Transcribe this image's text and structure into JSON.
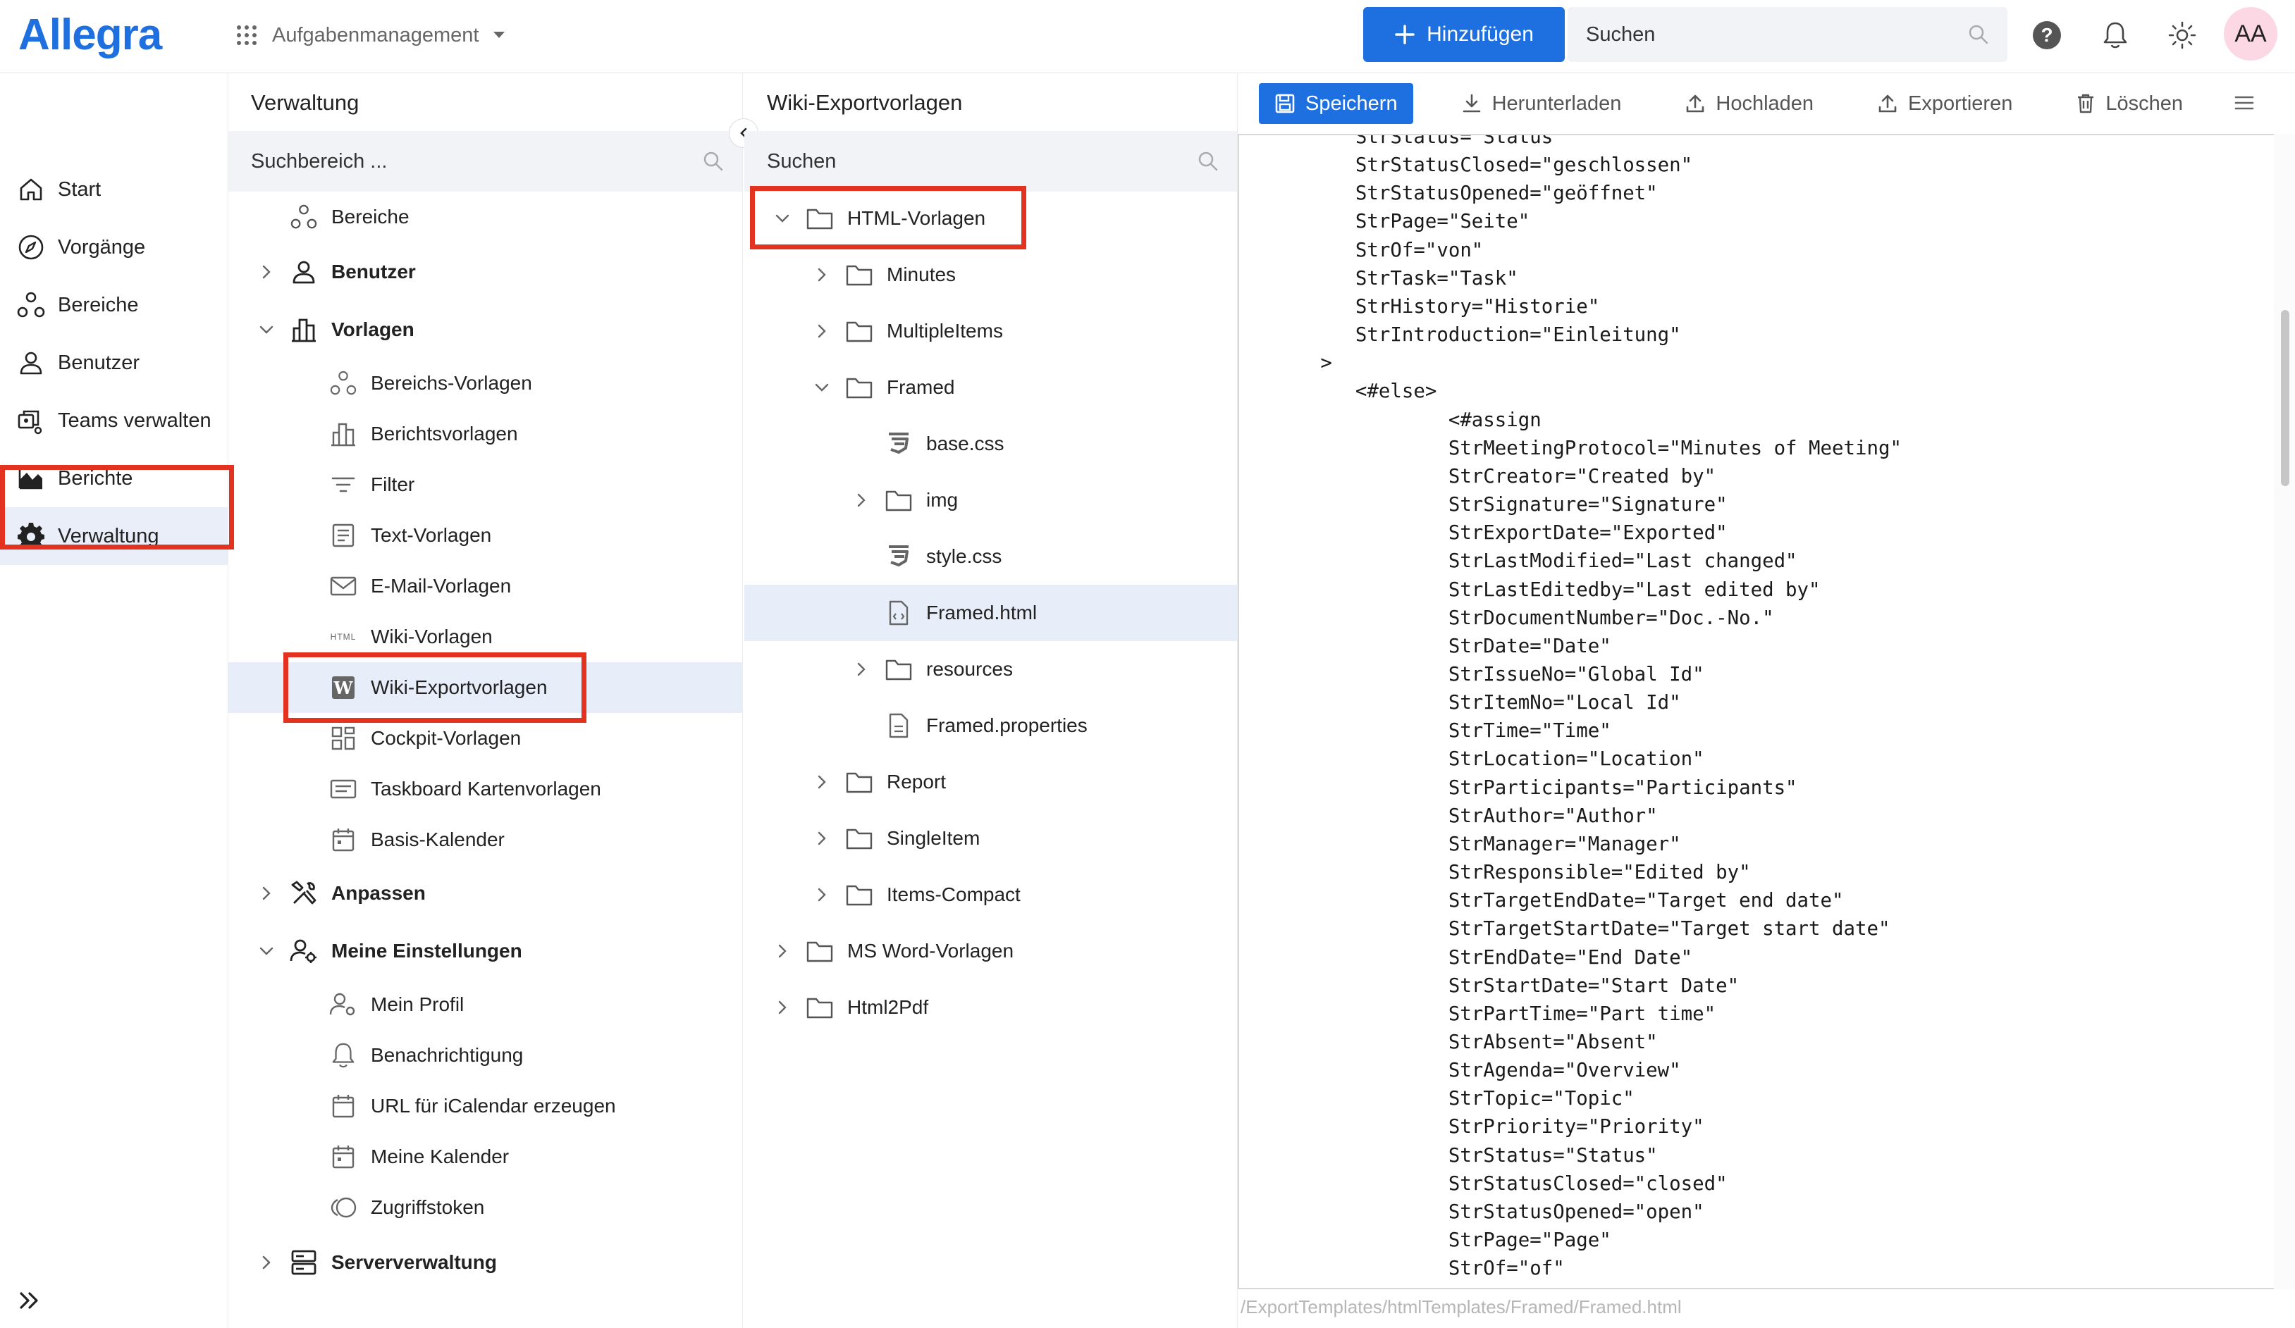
{
  "header": {
    "logo": "Allegra",
    "app_switcher_label": "Aufgabenmanagement",
    "add_button_label": "Hinzufügen",
    "search_placeholder": "Suchen",
    "avatar_initials": "AA",
    "brand_color": "#1e6fe0"
  },
  "leftnav": {
    "items": [
      {
        "label": "Start",
        "icon": "home-icon"
      },
      {
        "label": "Vorgänge",
        "icon": "compass-icon"
      },
      {
        "label": "Bereiche",
        "icon": "nodes-icon"
      },
      {
        "label": "Benutzer",
        "icon": "user-icon"
      },
      {
        "label": "Teams verwalten",
        "icon": "teams-icon"
      },
      {
        "label": "Berichte",
        "icon": "chart-area-icon"
      },
      {
        "label": "Verwaltung",
        "icon": "gear-icon",
        "active": true
      }
    ]
  },
  "admin_panel": {
    "title": "Verwaltung",
    "search_placeholder": "Suchbereich ...",
    "items": [
      {
        "label": "Bereiche"
      },
      {
        "label": "Benutzer"
      },
      {
        "label": "Vorlagen"
      },
      {
        "label": "Bereichs-Vorlagen"
      },
      {
        "label": "Berichtsvorlagen"
      },
      {
        "label": "Filter"
      },
      {
        "label": "Text-Vorlagen"
      },
      {
        "label": "E-Mail-Vorlagen"
      },
      {
        "label": "Wiki-Vorlagen",
        "icon_text": "HTML"
      },
      {
        "label": "Wiki-Exportvorlagen",
        "icon_text": "W",
        "selected": true
      },
      {
        "label": "Cockpit-Vorlagen"
      },
      {
        "label": "Taskboard Kartenvorlagen"
      },
      {
        "label": "Basis-Kalender"
      },
      {
        "label": "Anpassen"
      },
      {
        "label": "Meine Einstellungen"
      },
      {
        "label": "Mein Profil"
      },
      {
        "label": "Benachrichtigung"
      },
      {
        "label": "URL für iCalendar erzeugen"
      },
      {
        "label": "Meine Kalender"
      },
      {
        "label": "Zugriffstoken"
      },
      {
        "label": "Serververwaltung"
      }
    ]
  },
  "wiki_panel": {
    "title": "Wiki-Exportvorlagen",
    "search_placeholder": "Suchen",
    "items": [
      {
        "label": "HTML-Vorlagen",
        "expanded": true
      },
      {
        "label": "Minutes"
      },
      {
        "label": "MultipleItems"
      },
      {
        "label": "Framed",
        "expanded": true
      },
      {
        "label": "base.css"
      },
      {
        "label": "img"
      },
      {
        "label": "style.css"
      },
      {
        "label": "Framed.html",
        "selected": true
      },
      {
        "label": "resources"
      },
      {
        "label": "Framed.properties"
      },
      {
        "label": "Report"
      },
      {
        "label": "SingleItem"
      },
      {
        "label": "Items-Compact"
      },
      {
        "label": "MS Word-Vorlagen"
      },
      {
        "label": "Html2Pdf"
      }
    ]
  },
  "editor": {
    "toolbar": {
      "save": "Speichern",
      "download": "Herunterladen",
      "upload": "Hochladen",
      "export": "Exportieren",
      "delete": "Löschen"
    },
    "code_lines": [
      "          StrStatus=\"Status\"",
      "          StrStatusClosed=\"geschlossen\"",
      "          StrStatusOpened=\"geöffnet\"",
      "          StrPage=\"Seite\"",
      "          StrOf=\"von\"",
      "          StrTask=\"Task\"",
      "          StrHistory=\"Historie\"",
      "          StrIntroduction=\"Einleitung\"",
      "       >",
      "          <#else>",
      "                  <#assign",
      "                  StrMeetingProtocol=\"Minutes of Meeting\"",
      "                  StrCreator=\"Created by\"",
      "                  StrSignature=\"Signature\"",
      "                  StrExportDate=\"Exported\"",
      "                  StrLastModified=\"Last changed\"",
      "                  StrLastEditedby=\"Last edited by\"",
      "                  StrDocumentNumber=\"Doc.-No.\"",
      "                  StrDate=\"Date\"",
      "                  StrIssueNo=\"Global Id\"",
      "                  StrItemNo=\"Local Id\"",
      "                  StrTime=\"Time\"",
      "                  StrLocation=\"Location\"",
      "                  StrParticipants=\"Participants\"",
      "                  StrAuthor=\"Author\"",
      "                  StrManager=\"Manager\"",
      "                  StrResponsible=\"Edited by\"",
      "                  StrTargetEndDate=\"Target end date\"",
      "                  StrTargetStartDate=\"Target start date\"",
      "                  StrEndDate=\"End Date\"",
      "                  StrStartDate=\"Start Date\"",
      "                  StrPartTime=\"Part time\"",
      "                  StrAbsent=\"Absent\"",
      "                  StrAgenda=\"Overview\"",
      "                  StrTopic=\"Topic\"",
      "                  StrPriority=\"Priority\"",
      "                  StrStatus=\"Status\"",
      "                  StrStatusClosed=\"closed\"",
      "                  StrStatusOpened=\"open\"",
      "                  StrPage=\"Page\"",
      "                  StrOf=\"of\""
    ],
    "file_path": "/ExportTemplates/htmlTemplates/Framed/Framed.html"
  }
}
